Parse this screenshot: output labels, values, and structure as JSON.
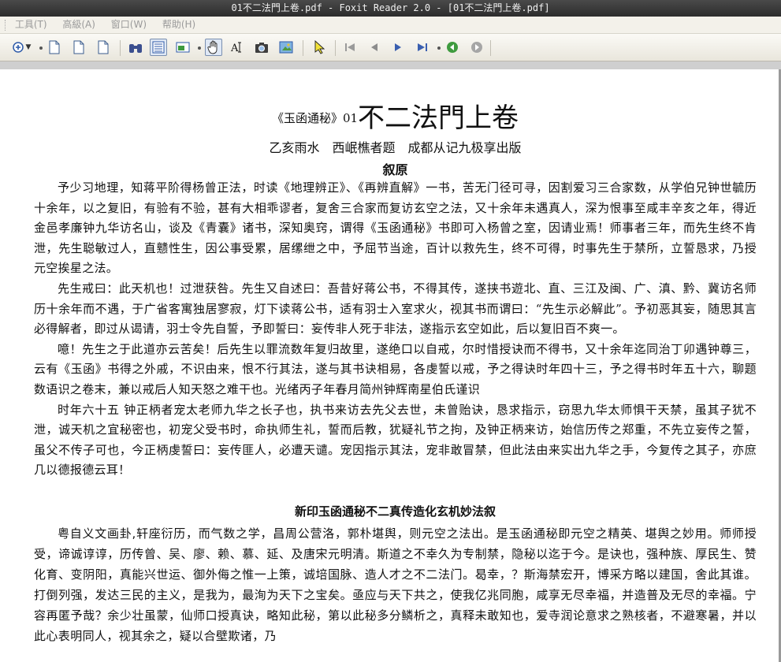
{
  "window": {
    "title": "01不二法門上卷.pdf - Foxit Reader 2.0 - [01不二法門上卷.pdf]"
  },
  "menubar": {
    "items": [
      "工具(T)",
      "高級(A)",
      "窗口(W)",
      "帮助(H)"
    ]
  },
  "toolbar": {
    "icons": [
      "zoom-in-icon",
      "new-page-icon",
      "page-icon",
      "page-icon",
      "binoculars-icon",
      "bookmarks-icon",
      "thumbnails-icon",
      "hand-tool-icon",
      "text-select-icon",
      "snapshot-icon",
      "image-tool-icon",
      "select-arrow-icon",
      "first-page-icon",
      "previous-page-icon",
      "next-page-icon",
      "last-page-icon",
      "go-back-icon",
      "go-forward-icon"
    ]
  },
  "document": {
    "title_prefix": "《玉函通秘》01",
    "title_main": "不二法門上卷",
    "subtitle": "乙亥雨水　西岷樵者题　成都从记九极享出版",
    "heading": "叙原",
    "paragraphs": [
      "予少习地理，知蒋平阶得杨曾正法，时读《地理辨正》、《再辨直解》一书，苦无门径可寻，因割爱习三合家数，从学伯兄钟世毓历十余年，以之复旧，有验有不验，甚有大相乖谬者，复舍三合家而复访玄空之法，又十余年未遇真人，深为恨事至咸丰辛亥之年，得近金邑孝廉钟九华访名山，谈及《青囊》诸书，深知奥窍，谓得《玉函通秘》书即可入杨曾之室，因请业焉！师事者三年，而先生终不肯泄，先生聪敏过人，直戆性生，因公事受累，居缧绁之中，予屈节当途，百计以救先生，终不可得，时事先生于禁所，立誓恳求，乃授元空挨星之法。",
      "先生戒曰：此天机也！过泄获咎。先生又自述曰：吾昔好蒋公书，不得其传，遂挟书遊北、直、三江及闽、广、滇、黔、冀访名师历十余年而不遇，于广省客寓独居寥寂，灯下读蒋公书，适有羽士入室求火，视其书而谓曰：“先生示必解此”。予初恶其妄，随思其言必得解者，即过从谒请，羽士令先自誓，予即誓曰：妄传非人死于非法，遂指示玄空如此，后以复旧百不爽一。",
      "噫！先生之于此道亦云苦矣！后先生以罪流数年复归故里，遂绝口以自戒，尔时惜授诀而不得书，又十余年迄同治丁卯遇钟尊三，云有《玉函》书得之外戚，不识由来，恨不行其法，遂与其书诀相易，各虔誓以戒，予之得诀时年四十三，予之得书时年五十六，聊题数语识之卷末，兼以戒后人知天怒之难干也。光绪丙子年春月简州钟辉南星伯氏谨识",
      "时年六十五 钟正柄者宠太老师九华之长子也，执书来访去先父去世，未曾贻诀，恳求指示，窃思九华太师惧干天禁，虽其子犹不泄，诚天机之宜秘密也，初宠父受书时，命执师生礼，誓而后教，犹疑礼节之拘，及钟正柄来访，始信历传之郑重，不先立妄传之誓，虽父不传子可也，今正柄虔誓曰：妄传匪人，必遭天谴。宠因指示其法，宠非敢冒禁，但此法由来实出九华之手，今复传之其子，亦庶几以德报德云耳！"
    ],
    "heading2": "新印玉函通秘不二真传造化玄机妙法叙",
    "paragraphs2": [
      "粤自义文画卦,轩座衍历，而气数之学，昌周公营洛，郭朴堪舆，则元空之法出。是玉函通秘即元空之精英、堪舆之妙用。师师授受，谛诚谆谆，历传曾、吴、廖、赖、慕、延、及唐宋元明清。斯道之不幸久为专制禁，隐秘以迄于今。是诀也，强种族、厚民生、赞化育、变阴阳，真能兴世运、御外侮之惟一上策，诚培国脉、造人才之不二法门。曷幸，？斯海禁宏开，博采方略以建国，舍此其谁。打倒列强，发达三民的主义，是我为，最洵为天下之宝矣。亟应与天下共之，使我亿兆同胞，咸享无尽幸福，并造普及无尽的幸福。宁容再匿予哉？余少壮虽蒙，仙师口授真诀，略知此秘，第以此秘多分鳞析之，真释未敢知也，爱寺润论意求之熟核者，不避寒暑，并以此心表明同人，视其余之，疑以合壁欺诸，乃"
    ]
  }
}
